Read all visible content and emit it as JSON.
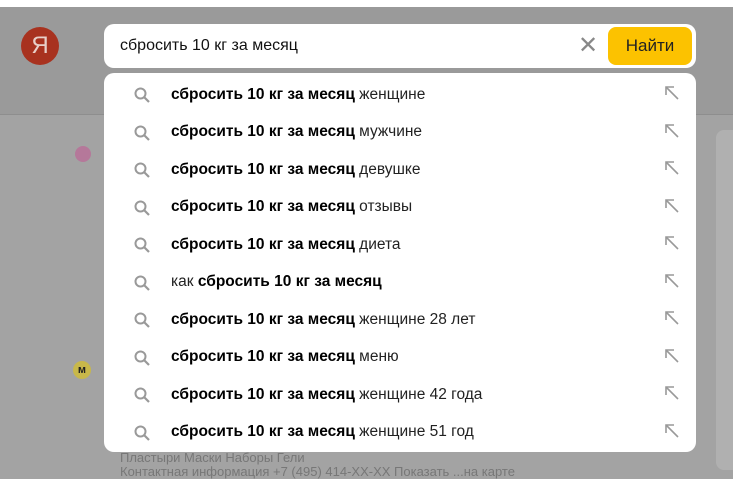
{
  "logo": "Я",
  "search": {
    "value": "сбросить 10 кг за месяц",
    "button": "Найти"
  },
  "suggestions": [
    {
      "bold_prefix": "",
      "bold": "сбросить 10 кг за месяц",
      "rest": " женщине"
    },
    {
      "bold_prefix": "",
      "bold": "сбросить 10 кг за месяц",
      "rest": " мужчине"
    },
    {
      "bold_prefix": "",
      "bold": "сбросить 10 кг за месяц",
      "rest": " девушке"
    },
    {
      "bold_prefix": "",
      "bold": "сбросить 10 кг за месяц",
      "rest": " отзывы"
    },
    {
      "bold_prefix": "",
      "bold": "сбросить 10 кг за месяц",
      "rest": " диета"
    },
    {
      "bold_prefix": "как ",
      "bold": "сбросить 10 кг за месяц",
      "rest": ""
    },
    {
      "bold_prefix": "",
      "bold": "сбросить 10 кг за месяц",
      "rest": " женщине 28 лет"
    },
    {
      "bold_prefix": "",
      "bold": "сбросить 10 кг за месяц",
      "rest": " меню"
    },
    {
      "bold_prefix": "",
      "bold": "сбросить 10 кг за месяц",
      "rest": " женщине 42 года"
    },
    {
      "bold_prefix": "",
      "bold": "сбросить 10 кг за месяц",
      "rest": " женщине 51 год"
    }
  ],
  "background": {
    "categories": "Пластыри    Маски    Наборы    Гели",
    "contacts": "Контактная информация   +7 (495) 414-XX-XX Показать   ...на карте"
  }
}
